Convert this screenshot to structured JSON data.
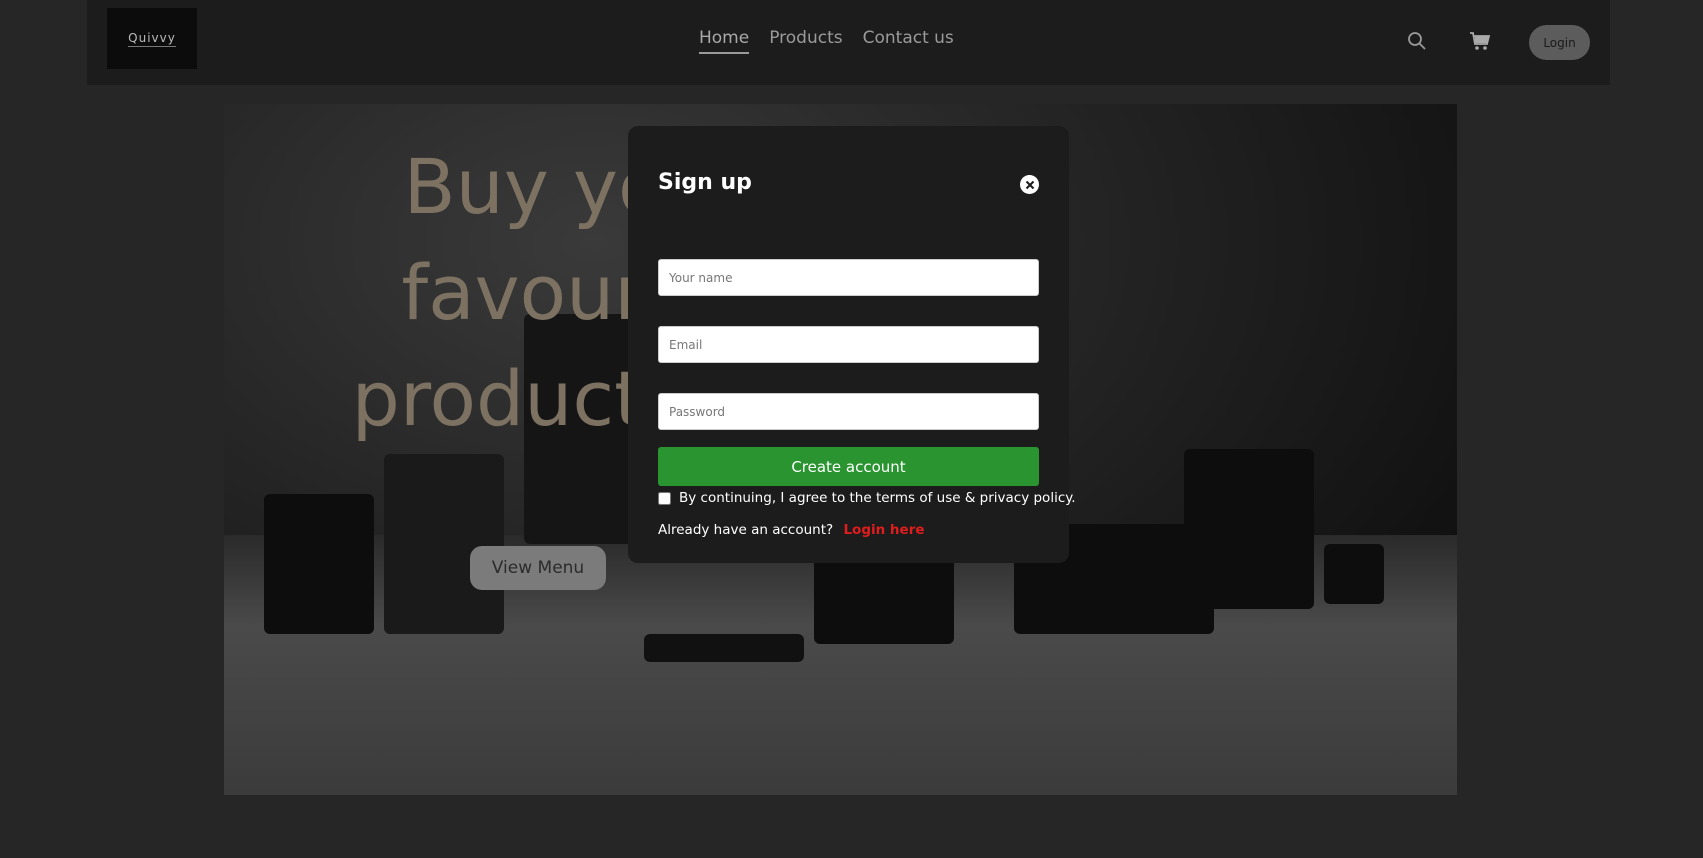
{
  "header": {
    "logo_text": "Quivvy",
    "nav": [
      {
        "label": "Home",
        "active": true
      },
      {
        "label": "Products",
        "active": false
      },
      {
        "label": "Contact us",
        "active": false
      }
    ],
    "icons": [
      "search-icon",
      "cart-icon"
    ],
    "login_label": "Login"
  },
  "hero": {
    "title_line1": "Buy yo",
    "title_line2": "favouri",
    "title_line3": "product h",
    "cta_label": "View Menu"
  },
  "modal": {
    "title": "Sign up",
    "name_placeholder": "Your name",
    "email_placeholder": "Email",
    "password_placeholder": "Password",
    "submit_label": "Create account",
    "agree_text": "By continuing, I agree to the terms of use & privacy policy.",
    "already_text": "Already have an account?",
    "login_link": "Login here"
  },
  "colors": {
    "accent_green": "#2a9530",
    "link_red": "#e01d1d",
    "hero_title": "#7d7262"
  }
}
